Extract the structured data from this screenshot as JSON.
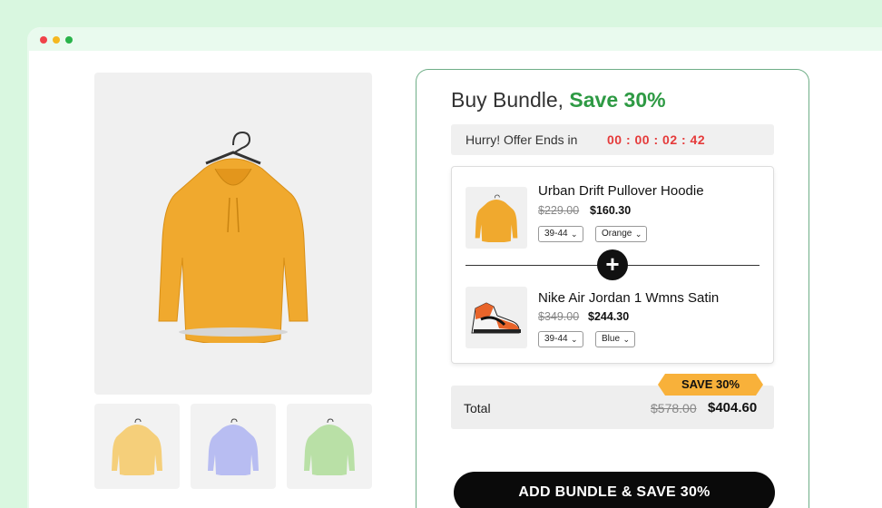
{
  "window": {
    "controls": [
      "close",
      "minimize",
      "maximize"
    ]
  },
  "gallery": {
    "main_image": "orange-hoodie-on-hanger",
    "thumbnails": [
      {
        "icon": "yellow-hoodie-thumbnail",
        "color": "#f5cf7a"
      },
      {
        "icon": "lavender-hoodie-thumbnail",
        "color": "#b8bdf2"
      },
      {
        "icon": "green-hoodie-thumbnail",
        "color": "#b9e0a6"
      }
    ]
  },
  "bundle": {
    "title": "Buy Bundle,",
    "title_highlight": "Save 30%",
    "timer_label": "Hurry! Offer Ends in",
    "timer_value": "00 : 00 : 02 : 42",
    "items": [
      {
        "name": "Urban Drift Pullover Hoodie",
        "old_price": "$229.00",
        "new_price": "$160.30",
        "size": "39-44",
        "color": "Orange",
        "icon": "orange-hoodie-icon"
      },
      {
        "name": "Nike Air Jordan 1 Wmns Satin",
        "old_price": "$349.00",
        "new_price": "$244.30",
        "size": "39-44",
        "color": "Blue",
        "icon": "sneaker-icon"
      }
    ],
    "plus_symbol": "+",
    "badge": "SAVE 30%",
    "total_label": "Total",
    "total_old": "$578.00",
    "total_new": "$404.60",
    "cta_label": "ADD BUNDLE & SAVE 30%"
  },
  "colors": {
    "accent_green": "#2e9a44",
    "timer_red": "#e53b3b",
    "badge_orange": "#f8b13a",
    "cta_black": "#0a0a0a"
  }
}
